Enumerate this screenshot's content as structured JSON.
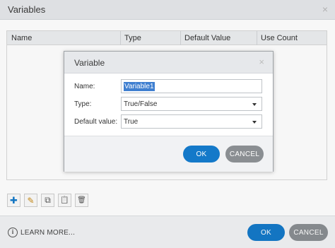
{
  "outer": {
    "title": "Variables",
    "close_glyph": "×",
    "columns": [
      "Name",
      "Type",
      "Default Value",
      "Use Count"
    ],
    "toolbar": [
      {
        "name": "add-icon",
        "glyph": "✚",
        "color": "#1479c9"
      },
      {
        "name": "edit-icon",
        "glyph": "✎",
        "color": "#c98a14"
      },
      {
        "name": "copy-icon",
        "glyph": "⧉",
        "color": "#555555"
      },
      {
        "name": "paste-icon",
        "glyph": "📋",
        "color": "#888888"
      },
      {
        "name": "trash-icon",
        "glyph": "🗑",
        "color": "#555555"
      }
    ],
    "learn_more": "LEARN MORE...",
    "info_glyph": "i",
    "ok_label": "OK",
    "cancel_label": "CANCEL"
  },
  "modal": {
    "title": "Variable",
    "close_glyph": "×",
    "name_label": "Name:",
    "name_value": "Variable1",
    "type_label": "Type:",
    "type_value": "True/False",
    "default_label": "Default value:",
    "default_value": "True",
    "ok_label": "OK",
    "cancel_label": "CANCEL"
  },
  "colors": {
    "accent": "#1479c9",
    "cancel": "#8a8e92",
    "header_bg": "#e6e8eb"
  }
}
